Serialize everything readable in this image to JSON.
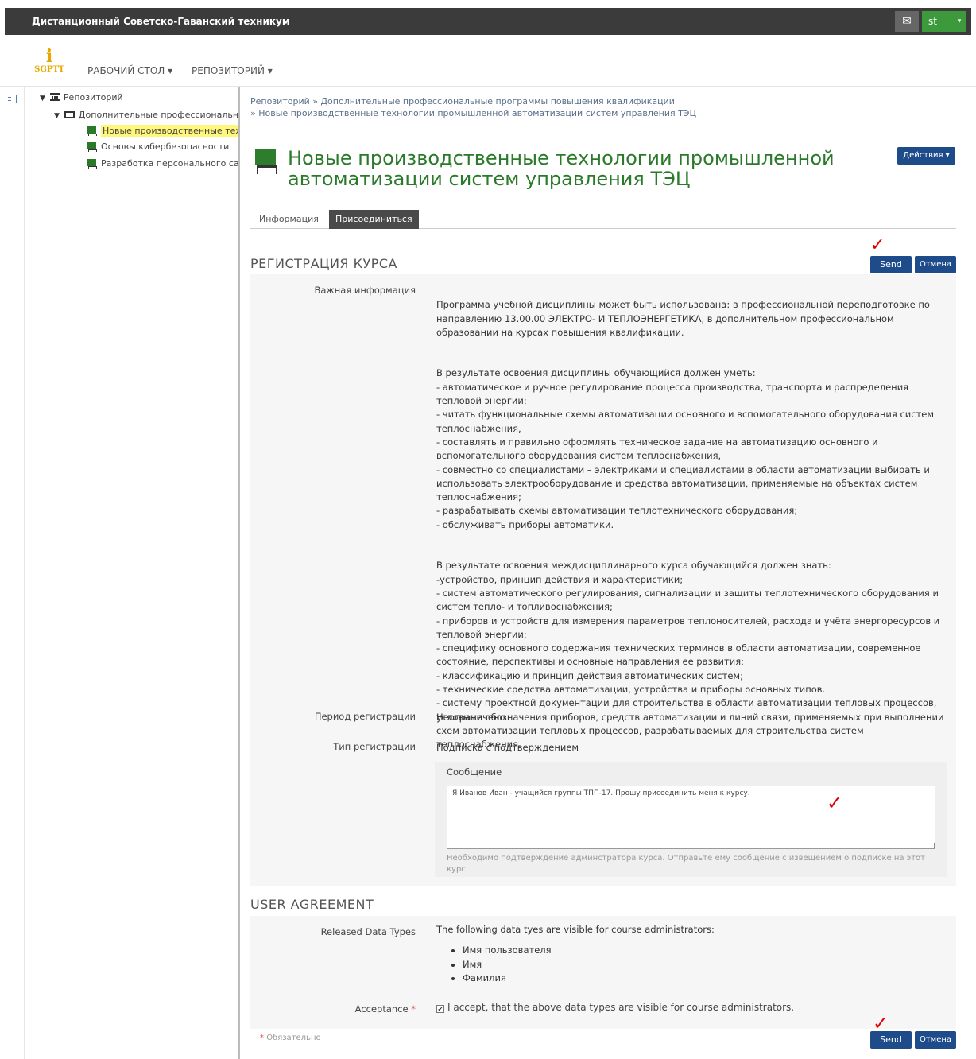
{
  "topbar": {
    "site_title": "Дистанционный Советско-Гаванский техникум",
    "mail_icon": "envelope-icon",
    "user_label": "st",
    "user_caret": "▾"
  },
  "nav": {
    "logo_letter": "i",
    "logo_text": "SGPTT",
    "desk": "РАБОЧИЙ СТОЛ ▾",
    "repo": "РЕПОЗИТОРИЙ ▾"
  },
  "tree": {
    "root": "Репозиторий",
    "folder": "Дополнительные профессиональные программы повышения квалификации",
    "items": [
      "Новые производственные технологии промышленной автоматизации систем управления ТЭЦ",
      "Основы кибербезопасности",
      "Разработка персонального сайта"
    ]
  },
  "breadcrumb": {
    "line1": "Репозиторий » Дополнительные профессиональные программы повышения квалификации",
    "line2": "» Новые производственные технологии промышленной автоматизации систем управления ТЭЦ"
  },
  "header": {
    "title_line1": "Новые производственные технологии промышленной",
    "title_line2": "автоматизации систем управления ТЭЦ",
    "actions": "Действия ▾"
  },
  "tabs": {
    "info": "Информация",
    "join": "Присоединиться"
  },
  "registration": {
    "section_title": "РЕГИСТРАЦИЯ КУРСА",
    "send": "Send",
    "cancel": "Отмена",
    "check_mark": "✓",
    "important_label": "Важная информация",
    "important_p1": "Программа учебной дисциплины может быть использована: в профессиональной переподготовке по направлению 13.00.00 ЭЛЕКТРО- И ТЕПЛОЭНЕРГЕТИКА, в дополнительном профессиональном образовании на курсах повышения квалификации.",
    "important_p2": "В результате освоения дисциплины обучающийся должен уметь:\n- автоматическое и ручное регулирование процесса производства, транспорта и распределения тепловой энергии;\n- читать функциональные схемы автоматизации основного и вспомогательного оборудования систем теплоснабжения,\n- составлять и правильно оформлять техническое задание на автоматизацию основного и вспомогательного оборудования систем теплоснабжения,\n- совместно со специалистами – электриками и специалистами в области автоматизации выбирать и использовать электрооборудование и средства автоматизации, применяемые на объектах систем теплоснабжения;\n- разрабатывать схемы автоматизации теплотехнического оборудования;\n- обслуживать приборы автоматики.",
    "important_p3": "В результате освоения междисциплинарного курса обучающийся должен знать:\n-устройство, принцип действия и характеристики;\n- систем автоматического регулирования, сигнализации и защиты теплотехнического оборудования и систем тепло- и топливоснабжения;\n- приборов и устройств для измерения параметров теплоносителей, расхода и учёта энергоресурсов и тепловой энергии;\n- специфику основного содержания технических терминов в области автоматизации, современное состояние, перспективы и основные направления ее развития;\n- классификацию и принцип действия автоматических систем;\n- технические средства автоматизации, устройства и приборы основных типов.\n- систему проектной документации для строительства в области автоматизации тепловых процессов, условные обозначения приборов, средств автоматизации и линий связи, применяемых при выполнении схем автоматизации тепловых процессов, разрабатываемых для строительства систем теплоснабжения.",
    "period_label": "Период регистрации",
    "period_value": "Неограничено",
    "type_label": "Тип регистрации",
    "type_value": "Подписка с подтверждением",
    "message_label": "Сообщение",
    "message_value": "Я Иванов Иван - учащийся группы ТПП-17. Прошу присоединить меня к курсу.",
    "message_help": "Необходимо подтверждение админстратора курса. Отправьте ему сообщение с извещением о подписке на этот курс."
  },
  "agreement": {
    "section_title": "USER AGREEMENT",
    "released_label": "Released Data Types",
    "released_intro": "The following data tyes are visible for course administrators:",
    "items": [
      "Имя пользователя",
      "Имя",
      "Фамилия"
    ],
    "acceptance_label": "Acceptance",
    "required_star": "*",
    "checkbox_mark": "✔",
    "accept_text": "I accept, that the above data types are visible for course administrators.",
    "required_note": "Обязательно",
    "send": "Send",
    "cancel": "Отмена"
  },
  "colors": {
    "topbar": "#3b3b3b",
    "accent_blue": "#1e4b8a",
    "title_green": "#2a7a2a",
    "user_green": "#3c9a3c",
    "highlight": "#fff77a",
    "check_red": "#e00000"
  }
}
